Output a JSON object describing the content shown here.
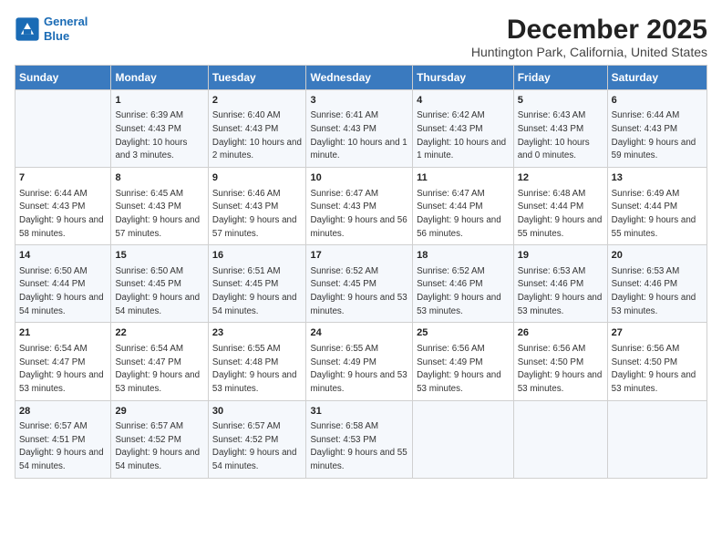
{
  "logo": {
    "line1": "General",
    "line2": "Blue"
  },
  "title": "December 2025",
  "subtitle": "Huntington Park, California, United States",
  "headers": [
    "Sunday",
    "Monday",
    "Tuesday",
    "Wednesday",
    "Thursday",
    "Friday",
    "Saturday"
  ],
  "weeks": [
    [
      {
        "day": "",
        "sunrise": "",
        "sunset": "",
        "daylight": ""
      },
      {
        "day": "1",
        "sunrise": "Sunrise: 6:39 AM",
        "sunset": "Sunset: 4:43 PM",
        "daylight": "Daylight: 10 hours and 3 minutes."
      },
      {
        "day": "2",
        "sunrise": "Sunrise: 6:40 AM",
        "sunset": "Sunset: 4:43 PM",
        "daylight": "Daylight: 10 hours and 2 minutes."
      },
      {
        "day": "3",
        "sunrise": "Sunrise: 6:41 AM",
        "sunset": "Sunset: 4:43 PM",
        "daylight": "Daylight: 10 hours and 1 minute."
      },
      {
        "day": "4",
        "sunrise": "Sunrise: 6:42 AM",
        "sunset": "Sunset: 4:43 PM",
        "daylight": "Daylight: 10 hours and 1 minute."
      },
      {
        "day": "5",
        "sunrise": "Sunrise: 6:43 AM",
        "sunset": "Sunset: 4:43 PM",
        "daylight": "Daylight: 10 hours and 0 minutes."
      },
      {
        "day": "6",
        "sunrise": "Sunrise: 6:44 AM",
        "sunset": "Sunset: 4:43 PM",
        "daylight": "Daylight: 9 hours and 59 minutes."
      }
    ],
    [
      {
        "day": "7",
        "sunrise": "Sunrise: 6:44 AM",
        "sunset": "Sunset: 4:43 PM",
        "daylight": "Daylight: 9 hours and 58 minutes."
      },
      {
        "day": "8",
        "sunrise": "Sunrise: 6:45 AM",
        "sunset": "Sunset: 4:43 PM",
        "daylight": "Daylight: 9 hours and 57 minutes."
      },
      {
        "day": "9",
        "sunrise": "Sunrise: 6:46 AM",
        "sunset": "Sunset: 4:43 PM",
        "daylight": "Daylight: 9 hours and 57 minutes."
      },
      {
        "day": "10",
        "sunrise": "Sunrise: 6:47 AM",
        "sunset": "Sunset: 4:43 PM",
        "daylight": "Daylight: 9 hours and 56 minutes."
      },
      {
        "day": "11",
        "sunrise": "Sunrise: 6:47 AM",
        "sunset": "Sunset: 4:44 PM",
        "daylight": "Daylight: 9 hours and 56 minutes."
      },
      {
        "day": "12",
        "sunrise": "Sunrise: 6:48 AM",
        "sunset": "Sunset: 4:44 PM",
        "daylight": "Daylight: 9 hours and 55 minutes."
      },
      {
        "day": "13",
        "sunrise": "Sunrise: 6:49 AM",
        "sunset": "Sunset: 4:44 PM",
        "daylight": "Daylight: 9 hours and 55 minutes."
      }
    ],
    [
      {
        "day": "14",
        "sunrise": "Sunrise: 6:50 AM",
        "sunset": "Sunset: 4:44 PM",
        "daylight": "Daylight: 9 hours and 54 minutes."
      },
      {
        "day": "15",
        "sunrise": "Sunrise: 6:50 AM",
        "sunset": "Sunset: 4:45 PM",
        "daylight": "Daylight: 9 hours and 54 minutes."
      },
      {
        "day": "16",
        "sunrise": "Sunrise: 6:51 AM",
        "sunset": "Sunset: 4:45 PM",
        "daylight": "Daylight: 9 hours and 54 minutes."
      },
      {
        "day": "17",
        "sunrise": "Sunrise: 6:52 AM",
        "sunset": "Sunset: 4:45 PM",
        "daylight": "Daylight: 9 hours and 53 minutes."
      },
      {
        "day": "18",
        "sunrise": "Sunrise: 6:52 AM",
        "sunset": "Sunset: 4:46 PM",
        "daylight": "Daylight: 9 hours and 53 minutes."
      },
      {
        "day": "19",
        "sunrise": "Sunrise: 6:53 AM",
        "sunset": "Sunset: 4:46 PM",
        "daylight": "Daylight: 9 hours and 53 minutes."
      },
      {
        "day": "20",
        "sunrise": "Sunrise: 6:53 AM",
        "sunset": "Sunset: 4:46 PM",
        "daylight": "Daylight: 9 hours and 53 minutes."
      }
    ],
    [
      {
        "day": "21",
        "sunrise": "Sunrise: 6:54 AM",
        "sunset": "Sunset: 4:47 PM",
        "daylight": "Daylight: 9 hours and 53 minutes."
      },
      {
        "day": "22",
        "sunrise": "Sunrise: 6:54 AM",
        "sunset": "Sunset: 4:47 PM",
        "daylight": "Daylight: 9 hours and 53 minutes."
      },
      {
        "day": "23",
        "sunrise": "Sunrise: 6:55 AM",
        "sunset": "Sunset: 4:48 PM",
        "daylight": "Daylight: 9 hours and 53 minutes."
      },
      {
        "day": "24",
        "sunrise": "Sunrise: 6:55 AM",
        "sunset": "Sunset: 4:49 PM",
        "daylight": "Daylight: 9 hours and 53 minutes."
      },
      {
        "day": "25",
        "sunrise": "Sunrise: 6:56 AM",
        "sunset": "Sunset: 4:49 PM",
        "daylight": "Daylight: 9 hours and 53 minutes."
      },
      {
        "day": "26",
        "sunrise": "Sunrise: 6:56 AM",
        "sunset": "Sunset: 4:50 PM",
        "daylight": "Daylight: 9 hours and 53 minutes."
      },
      {
        "day": "27",
        "sunrise": "Sunrise: 6:56 AM",
        "sunset": "Sunset: 4:50 PM",
        "daylight": "Daylight: 9 hours and 53 minutes."
      }
    ],
    [
      {
        "day": "28",
        "sunrise": "Sunrise: 6:57 AM",
        "sunset": "Sunset: 4:51 PM",
        "daylight": "Daylight: 9 hours and 54 minutes."
      },
      {
        "day": "29",
        "sunrise": "Sunrise: 6:57 AM",
        "sunset": "Sunset: 4:52 PM",
        "daylight": "Daylight: 9 hours and 54 minutes."
      },
      {
        "day": "30",
        "sunrise": "Sunrise: 6:57 AM",
        "sunset": "Sunset: 4:52 PM",
        "daylight": "Daylight: 9 hours and 54 minutes."
      },
      {
        "day": "31",
        "sunrise": "Sunrise: 6:58 AM",
        "sunset": "Sunset: 4:53 PM",
        "daylight": "Daylight: 9 hours and 55 minutes."
      },
      {
        "day": "",
        "sunrise": "",
        "sunset": "",
        "daylight": ""
      },
      {
        "day": "",
        "sunrise": "",
        "sunset": "",
        "daylight": ""
      },
      {
        "day": "",
        "sunrise": "",
        "sunset": "",
        "daylight": ""
      }
    ]
  ]
}
